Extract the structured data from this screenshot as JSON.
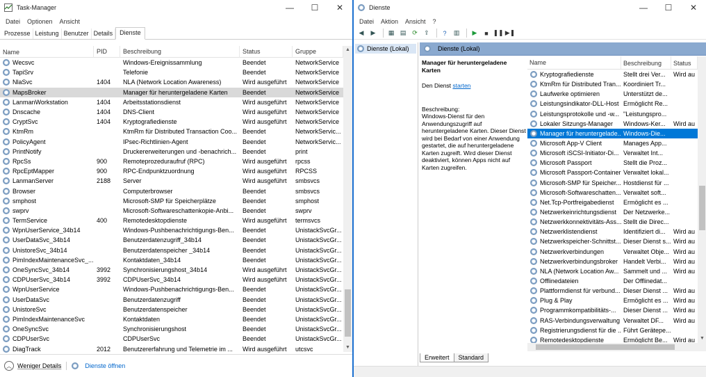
{
  "taskmanager": {
    "title": "Task-Manager",
    "menu": [
      "Datei",
      "Optionen",
      "Ansicht"
    ],
    "tabs": [
      "Prozesse",
      "Leistung",
      "Benutzer",
      "Details",
      "Dienste"
    ],
    "columns": {
      "name": "Name",
      "pid": "PID",
      "desc": "Beschreibung",
      "status": "Status",
      "group": "Gruppe"
    },
    "rows": [
      {
        "name": "Wecsvc",
        "pid": "",
        "desc": "Windows-Ereignissammlung",
        "status": "Beendet",
        "group": "NetworkService"
      },
      {
        "name": "TapiSrv",
        "pid": "",
        "desc": "Telefonie",
        "status": "Beendet",
        "group": "NetworkService"
      },
      {
        "name": "NlaSvc",
        "pid": "1404",
        "desc": "NLA (Network Location Awareness)",
        "status": "Wird ausgeführt",
        "group": "NetworkService"
      },
      {
        "name": "MapsBroker",
        "pid": "",
        "desc": "Manager für heruntergeladene Karten",
        "status": "Beendet",
        "group": "NetworkService",
        "sel": true
      },
      {
        "name": "LanmanWorkstation",
        "pid": "1404",
        "desc": "Arbeitsstationsdienst",
        "status": "Wird ausgeführt",
        "group": "NetworkService"
      },
      {
        "name": "Dnscache",
        "pid": "1404",
        "desc": "DNS-Client",
        "status": "Wird ausgeführt",
        "group": "NetworkService"
      },
      {
        "name": "CryptSvc",
        "pid": "1404",
        "desc": "Kryptografiedienste",
        "status": "Wird ausgeführt",
        "group": "NetworkService"
      },
      {
        "name": "KtmRm",
        "pid": "",
        "desc": "KtmRm für Distributed Transaction Coo...",
        "status": "Beendet",
        "group": "NetworkServic..."
      },
      {
        "name": "PolicyAgent",
        "pid": "",
        "desc": "IPsec-Richtlinien-Agent",
        "status": "Beendet",
        "group": "NetworkServic..."
      },
      {
        "name": "PrintNotify",
        "pid": "",
        "desc": "Druckererweiterungen und -benachrich...",
        "status": "Beendet",
        "group": "print"
      },
      {
        "name": "RpcSs",
        "pid": "900",
        "desc": "Remoteprozeduraufruf (RPC)",
        "status": "Wird ausgeführt",
        "group": "rpcss"
      },
      {
        "name": "RpcEptMapper",
        "pid": "900",
        "desc": "RPC-Endpunktzuordnung",
        "status": "Wird ausgeführt",
        "group": "RPCSS"
      },
      {
        "name": "LanmanServer",
        "pid": "2188",
        "desc": "Server",
        "status": "Wird ausgeführt",
        "group": "smbsvcs"
      },
      {
        "name": "Browser",
        "pid": "",
        "desc": "Computerbrowser",
        "status": "Beendet",
        "group": "smbsvcs"
      },
      {
        "name": "smphost",
        "pid": "",
        "desc": "Microsoft-SMP für Speicherplätze",
        "status": "Beendet",
        "group": "smphost"
      },
      {
        "name": "swprv",
        "pid": "",
        "desc": "Microsoft-Softwareschattenkopie-Anbi...",
        "status": "Beendet",
        "group": "swprv"
      },
      {
        "name": "TermService",
        "pid": "400",
        "desc": "Remotedesktopdienste",
        "status": "Wird ausgeführt",
        "group": "termsvcs"
      },
      {
        "name": "WpnUserService_34b14",
        "pid": "",
        "desc": "Windows-Pushbenachrichtigungs-Ben...",
        "status": "Beendet",
        "group": "UnistackSvcGr..."
      },
      {
        "name": "UserDataSvc_34b14",
        "pid": "",
        "desc": "Benutzerdatenzugriff_34b14",
        "status": "Beendet",
        "group": "UnistackSvcGr..."
      },
      {
        "name": "UnistoreSvc_34b14",
        "pid": "",
        "desc": "Benutzerdatenspeicher _34b14",
        "status": "Beendet",
        "group": "UnistackSvcGr..."
      },
      {
        "name": "PimIndexMaintenanceSvc_...",
        "pid": "",
        "desc": "Kontaktdaten_34b14",
        "status": "Beendet",
        "group": "UnistackSvcGr..."
      },
      {
        "name": "OneSyncSvc_34b14",
        "pid": "3992",
        "desc": "Synchronisierungshost_34b14",
        "status": "Wird ausgeführt",
        "group": "UnistackSvcGr..."
      },
      {
        "name": "CDPUserSvc_34b14",
        "pid": "3992",
        "desc": "CDPUserSvc_34b14",
        "status": "Wird ausgeführt",
        "group": "UnistackSvcGr..."
      },
      {
        "name": "WpnUserService",
        "pid": "",
        "desc": "Windows-Pushbenachrichtigungs-Ben...",
        "status": "Beendet",
        "group": "UnistackSvcGr..."
      },
      {
        "name": "UserDataSvc",
        "pid": "",
        "desc": "Benutzerdatenzugriff",
        "status": "Beendet",
        "group": "UnistackSvcGr..."
      },
      {
        "name": "UnistoreSvc",
        "pid": "",
        "desc": "Benutzerdatenspeicher",
        "status": "Beendet",
        "group": "UnistackSvcGr..."
      },
      {
        "name": "PimIndexMaintenanceSvc",
        "pid": "",
        "desc": "Kontaktdaten",
        "status": "Beendet",
        "group": "UnistackSvcGr..."
      },
      {
        "name": "OneSyncSvc",
        "pid": "",
        "desc": "Synchronisierungshost",
        "status": "Beendet",
        "group": "UnistackSvcGr..."
      },
      {
        "name": "CDPUserSvc",
        "pid": "",
        "desc": "CDPUserSvc",
        "status": "Beendet",
        "group": "UnistackSvcGr..."
      },
      {
        "name": "DiagTrack",
        "pid": "2012",
        "desc": "Benutzererfahrung und Telemetrie im ...",
        "status": "Wird ausgeführt",
        "group": "utcsvc"
      }
    ],
    "footer": {
      "fewer": "Weniger Details",
      "open_services": "Dienste öffnen"
    }
  },
  "services": {
    "title": "Dienste",
    "menu": [
      "Datei",
      "Aktion",
      "Ansicht",
      "?"
    ],
    "nav_item": "Dienste (Lokal)",
    "header": "Dienste (Lokal)",
    "selected_title": "Manager für heruntergeladene Karten",
    "start_prefix": "Den Dienst ",
    "start_link": "starten",
    "desc_label": "Beschreibung:",
    "desc_text": "Windows-Dienst für den Anwendungszugriff auf heruntergeladene Karten. Dieser Dienst wird bei Bedarf von einer Anwendung gestartet, die auf heruntergeladene Karten zugreift. Wird dieser Dienst deaktiviert, können Apps nicht auf Karten zugreifen.",
    "columns": {
      "name": "Name",
      "desc": "Beschreibung",
      "status": "Status"
    },
    "rows": [
      {
        "name": "Kryptografiedienste",
        "desc": "Stellt drei Ver...",
        "status": "Wird au"
      },
      {
        "name": "KtmRm für Distributed Tran...",
        "desc": "Koordiniert Tr...",
        "status": ""
      },
      {
        "name": "Laufwerke optimieren",
        "desc": "Unterstützt de...",
        "status": ""
      },
      {
        "name": "Leistungsindikator-DLL-Host",
        "desc": "Ermöglicht Re...",
        "status": ""
      },
      {
        "name": "Leistungsprotokolle und -w...",
        "desc": "\"Leistungspro...",
        "status": ""
      },
      {
        "name": "Lokaler Sitzungs-Manager",
        "desc": "Windows-Ker...",
        "status": "Wird au"
      },
      {
        "name": "Manager für heruntergelade...",
        "desc": "Windows-Die...",
        "status": "",
        "sel": true
      },
      {
        "name": "Microsoft App-V Client",
        "desc": "Manages App...",
        "status": ""
      },
      {
        "name": "Microsoft iSCSI-Initiator-Di...",
        "desc": "Verwaltet Int...",
        "status": ""
      },
      {
        "name": "Microsoft Passport",
        "desc": "Stellt die Proz...",
        "status": ""
      },
      {
        "name": "Microsoft Passport-Container",
        "desc": "Verwaltet lokal...",
        "status": ""
      },
      {
        "name": "Microsoft-SMP für Speicher...",
        "desc": "Hostdienst für ...",
        "status": ""
      },
      {
        "name": "Microsoft-Softwareschatten...",
        "desc": "Verwaltet soft...",
        "status": ""
      },
      {
        "name": "Net.Tcp-Portfreigabedienst",
        "desc": "Ermöglicht es ...",
        "status": ""
      },
      {
        "name": "Netzwerkeinrichtungsdienst",
        "desc": "Der Netzwerke...",
        "status": ""
      },
      {
        "name": "Netzwerkkonnektivitäts-Ass...",
        "desc": "Stellt die Direc...",
        "status": ""
      },
      {
        "name": "Netzwerklistendienst",
        "desc": "Identifiziert di...",
        "status": "Wird au"
      },
      {
        "name": "Netzwerkspeicher-Schnittst...",
        "desc": "Dieser Dienst s...",
        "status": "Wird au"
      },
      {
        "name": "Netzwerkverbindungen",
        "desc": "Verwaltet Obje...",
        "status": "Wird au"
      },
      {
        "name": "Netzwerkverbindungsbroker",
        "desc": "Handelt Verbi...",
        "status": "Wird au"
      },
      {
        "name": "NLA (Network Location Aw...",
        "desc": "Sammelt und ...",
        "status": "Wird au"
      },
      {
        "name": "Offlinedateien",
        "desc": "Der Offlinedat...",
        "status": ""
      },
      {
        "name": "Plattformdienst für verbund...",
        "desc": "Dieser Dienst ...",
        "status": "Wird au"
      },
      {
        "name": "Plug & Play",
        "desc": "Ermöglicht es ...",
        "status": "Wird au"
      },
      {
        "name": "Programmkompatibilitäts-...",
        "desc": "Dieser Dienst ...",
        "status": "Wird au"
      },
      {
        "name": "RAS-Verbindungsverwaltung",
        "desc": "Verwaltet DF...",
        "status": "Wird au"
      },
      {
        "name": "Registrierungsdienst für die ...",
        "desc": "Führt Geräteре...",
        "status": ""
      },
      {
        "name": "Remotedesktopdienste",
        "desc": "Ermöglicht Be...",
        "status": "Wird au"
      }
    ],
    "tabs": [
      "Erweitert",
      "Standard"
    ]
  }
}
